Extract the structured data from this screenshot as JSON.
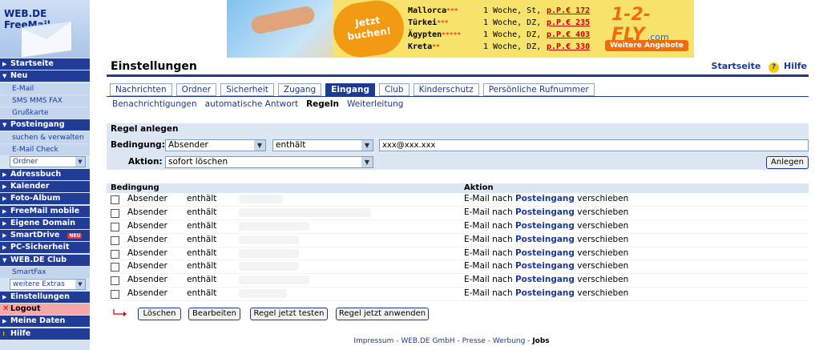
{
  "sidebar": {
    "logo": "WEB.DE FreeMail",
    "items": [
      {
        "type": "item",
        "label": "Startseite",
        "arrow": "▶"
      },
      {
        "type": "item",
        "label": "Neu",
        "arrow": "▼"
      },
      {
        "type": "sub",
        "label": "E-Mail"
      },
      {
        "type": "sub",
        "label": "SMS  MMS  FAX"
      },
      {
        "type": "sub",
        "label": "Grußkarte"
      },
      {
        "type": "item",
        "label": "Posteingang",
        "arrow": "▼"
      },
      {
        "type": "sub",
        "label": "suchen & verwalten"
      },
      {
        "type": "sub",
        "label": "E-Mail Check"
      },
      {
        "type": "select",
        "label": "Ordner"
      },
      {
        "type": "item",
        "label": "Adressbuch",
        "arrow": "▶"
      },
      {
        "type": "item",
        "label": "Kalender",
        "arrow": "▶"
      },
      {
        "type": "item",
        "label": "Foto-Album",
        "arrow": "▶"
      },
      {
        "type": "item",
        "label": "FreeMail mobile",
        "arrow": "▶"
      },
      {
        "type": "item",
        "label": "Eigene Domain",
        "arrow": "▶"
      },
      {
        "type": "item",
        "label": "SmartDrive",
        "arrow": "▶",
        "badge": "NEU"
      },
      {
        "type": "item",
        "label": "PC-Sicherheit",
        "arrow": "▶"
      },
      {
        "type": "item",
        "label": "WEB.DE Club",
        "arrow": "▼"
      },
      {
        "type": "sub",
        "label": "SmartFax"
      },
      {
        "type": "select",
        "label": "weitere Extras"
      },
      {
        "type": "item",
        "label": "Einstellungen",
        "arrow": "▶"
      },
      {
        "type": "logout",
        "label": "Logout",
        "arrow": "✕"
      },
      {
        "type": "item",
        "label": "Meine Daten",
        "arrow": "▶"
      },
      {
        "type": "help",
        "label": "Hilfe",
        "arrow": "!"
      }
    ]
  },
  "banner": {
    "cta": "Jetzt buchen!",
    "deals": [
      {
        "dest": "Mallorca",
        "stars": "***",
        "duration": "1 Woche, St,",
        "price": "p.P.€ 172"
      },
      {
        "dest": "Türkei",
        "stars": "***",
        "duration": "1 Woche, DZ,",
        "price": "p.P.€ 235"
      },
      {
        "dest": "Ägypten",
        "stars": "*****",
        "duration": "1 Woche, DZ,",
        "price": "p.P.€ 403"
      },
      {
        "dest": "Kreta",
        "stars": "**",
        "duration": "1 Woche, DZ,",
        "price": "p.P.€ 330"
      }
    ],
    "logo": "1-2-FLY",
    "logo_suffix": ".com",
    "more": "Weitere Angebote"
  },
  "header": {
    "title": "Einstellungen",
    "link_home": "Startseite",
    "link_help": "Hilfe"
  },
  "tabs": [
    "Nachrichten",
    "Ordner",
    "Sicherheit",
    "Zugang",
    "Eingang",
    "Club",
    "Kinderschutz",
    "Persönliche Rufnummer"
  ],
  "active_tab": "Eingang",
  "subtabs": [
    "Benachrichtigungen",
    "automatische Antwort",
    "Regeln",
    "Weiterleitung"
  ],
  "active_subtab": "Regeln",
  "rule_form": {
    "title": "Regel anlegen",
    "condition_label": "Bedingung:",
    "field_value": "Absender",
    "operator_value": "enthält",
    "text_value": "xxx@xxx.xxx",
    "action_label": "Aktion:",
    "action_value": "sofort löschen",
    "create_button": "Anlegen"
  },
  "rules_table": {
    "headers": {
      "condition": "Bedingung",
      "action": "Aktion"
    },
    "rows": [
      {
        "field": "Absender",
        "operator": "enthält",
        "action_prefix": "E-Mail nach",
        "folder": "Posteingang",
        "action_suffix": "verschieben"
      },
      {
        "field": "Absender",
        "operator": "enthält",
        "action_prefix": "E-Mail nach",
        "folder": "Posteingang",
        "action_suffix": "verschieben"
      },
      {
        "field": "Absender",
        "operator": "enthält",
        "action_prefix": "E-Mail nach",
        "folder": "Posteingang",
        "action_suffix": "verschieben"
      },
      {
        "field": "Absender",
        "operator": "enthält",
        "action_prefix": "E-Mail nach",
        "folder": "Posteingang",
        "action_suffix": "verschieben"
      },
      {
        "field": "Absender",
        "operator": "enthält",
        "action_prefix": "E-Mail nach",
        "folder": "Posteingang",
        "action_suffix": "verschieben"
      },
      {
        "field": "Absender",
        "operator": "enthält",
        "action_prefix": "E-Mail nach",
        "folder": "Posteingang",
        "action_suffix": "verschieben"
      },
      {
        "field": "Absender",
        "operator": "enthält",
        "action_prefix": "E-Mail nach",
        "folder": "Posteingang",
        "action_suffix": "verschieben"
      },
      {
        "field": "Absender",
        "operator": "enthält",
        "action_prefix": "E-Mail nach",
        "folder": "Posteingang",
        "action_suffix": "verschieben"
      }
    ]
  },
  "actions": {
    "delete": "Löschen",
    "edit": "Bearbeiten",
    "test": "Regel jetzt testen",
    "apply": "Regel jetzt anwenden"
  },
  "footer": {
    "links": [
      "Impressum",
      "WEB.DE GmbH",
      "Presse",
      "Werbung"
    ],
    "bold": "Jobs"
  }
}
